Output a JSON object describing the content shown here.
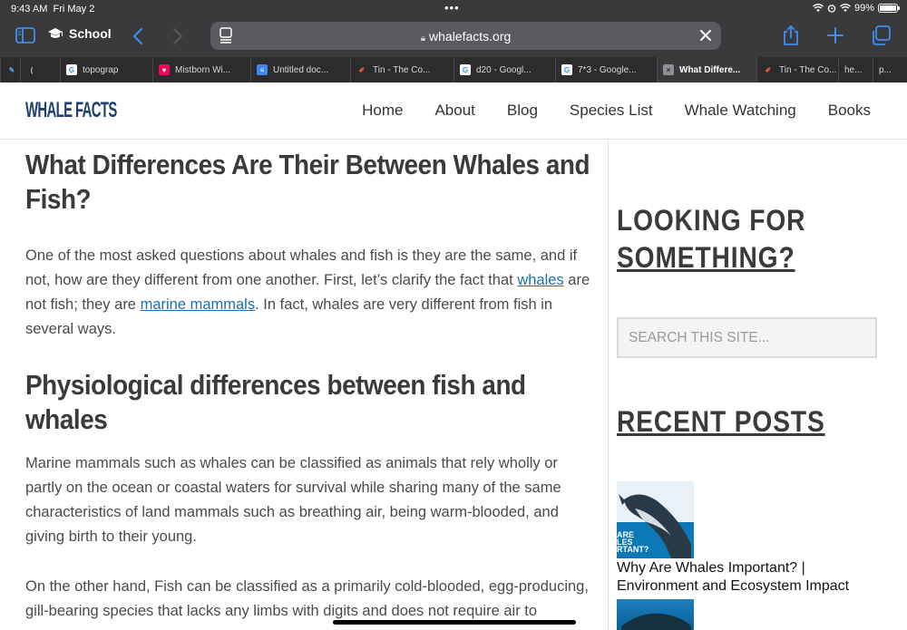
{
  "status": {
    "time": "9:43 AM",
    "date": "Fri May 2",
    "battery": "99%",
    "battery_level": 0.99
  },
  "toolbar": {
    "tab_group": "School",
    "address": "whalefacts.org"
  },
  "tabs": [
    {
      "label": "",
      "icon": "pencil-icon"
    },
    {
      "label": "",
      "icon": "partial-icon"
    },
    {
      "label": "topograp",
      "icon": "google-icon"
    },
    {
      "label": "Mistborn Wi...",
      "icon": "fandom-icon"
    },
    {
      "label": "Untitled doc...",
      "icon": "docs-icon"
    },
    {
      "label": "Tin - The Co...",
      "icon": "feather-icon"
    },
    {
      "label": "d20 - Googl...",
      "icon": "google-icon"
    },
    {
      "label": "7*3 - Google...",
      "icon": "google-icon"
    },
    {
      "label": "What Differe...",
      "icon": "close-icon",
      "active": true
    },
    {
      "label": "Tin - The Co...",
      "icon": "feather-icon"
    },
    {
      "label": "he...",
      "icon": "none"
    },
    {
      "label": "p...",
      "icon": "none"
    }
  ],
  "site": {
    "logo": "WHALE FACTS",
    "nav": [
      "Home",
      "About",
      "Blog",
      "Species List",
      "Whale Watching",
      "Books"
    ]
  },
  "article": {
    "title": "What Differences Are Their Between Whales and Fish?",
    "p1_a": "One of the most asked questions about whales and fish is they are the same, and if not, how are they different from one another. First, let’s clarify the fact that ",
    "p1_link1": "whales",
    "p1_b": " are not fish; they are ",
    "p1_link2": "marine mammals",
    "p1_c": ". In fact, whales are very different from fish in several ways.",
    "h2": "Physiological differences between fish and whales",
    "p2": "Marine mammals such as whales can be classified as animals that rely wholly or partly on the ocean or coastal waters for survival while sharing many of the same characteristics of land mammals such as breathing air, being warm-blooded, and giving birth to their young.",
    "p3": "On the other hand, Fish can be classified as a primarily cold-blooded, egg-producing, gill-bearing species that lacks any limbs with digits and does not require air to"
  },
  "sidebar": {
    "looking_line1": "LOOKING FOR",
    "looking_line2": "SOMETHING?",
    "search_placeholder": "SEARCH THIS SITE...",
    "recent_posts": "RECENT POSTS",
    "post1_thumb_text": "ARE\nLES\nRTANT?",
    "post1_title": "Why Are Whales Important? | Environment and Ecosystem Impact"
  },
  "colors": {
    "chrome": "#3a3a3c",
    "link": "#1a6fb0",
    "logo": "#1d4070"
  }
}
